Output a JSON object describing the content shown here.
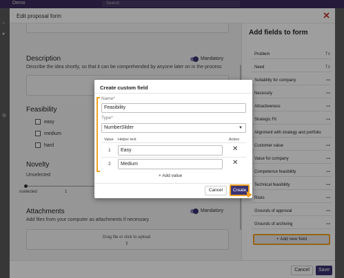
{
  "app": {
    "title": "Demo",
    "search_placeholder": "Search"
  },
  "dialog": {
    "title": "Edit proposal form",
    "close_icon": "close-icon"
  },
  "form": {
    "description": {
      "title": "Description",
      "mandatory_label": "Mandatory",
      "hint": "Describe the idea shortly, so that it can be comprehended by anyone later on in the process"
    },
    "feasibility": {
      "title": "Feasibility",
      "options": [
        "easy",
        "medium",
        "hard"
      ]
    },
    "novelty": {
      "title": "Novelty",
      "status": "Unselected",
      "slider_labels": [
        "nselected",
        "1"
      ]
    },
    "attachments": {
      "title": "Attachments",
      "mandatory_label": "Mandatory",
      "hint": "Add files from your computer as attachments if necessary",
      "dropzone": "Drag file or click to upload"
    }
  },
  "sidebar": {
    "title": "Add fields to form",
    "items": [
      {
        "label": "Problem",
        "icon": "text-icon"
      },
      {
        "label": "Need",
        "icon": "text-icon"
      },
      {
        "label": "Suitability for company",
        "icon": "slider-icon"
      },
      {
        "label": "Necessity",
        "icon": "slider-icon"
      },
      {
        "label": "Attractiveness",
        "icon": "slider-icon"
      },
      {
        "label": "Strategic Fit",
        "icon": "slider-icon"
      },
      {
        "label": "Alignment with strategy and portfolio",
        "icon": "slider-icon"
      },
      {
        "label": "Customer value",
        "icon": "slider-icon"
      },
      {
        "label": "Value for company",
        "icon": "slider-icon"
      },
      {
        "label": "Competence feasibility",
        "icon": "slider-icon"
      },
      {
        "label": "Technical feasibility",
        "icon": "slider-icon"
      },
      {
        "label": "Risks",
        "icon": "slider-icon"
      },
      {
        "label": "Grounds of approval",
        "icon": "slider-icon"
      },
      {
        "label": "Grounds of archiving",
        "icon": "slider-icon"
      }
    ],
    "add_new_field": "Add new field"
  },
  "footer": {
    "cancel": "Cancel",
    "save": "Save"
  },
  "modal": {
    "title": "Create custom field",
    "name_label": "Name*",
    "name_value": "Feasibility",
    "type_label": "Type*",
    "type_value": "NumberSlider",
    "col_value": "Value",
    "col_helper": "Helper text",
    "col_action": "Action",
    "rows": [
      {
        "value": "1",
        "helper": "Easy"
      },
      {
        "value": "2",
        "helper": "Medium"
      }
    ],
    "add_value": "Add value",
    "cancel": "Cancel",
    "create": "Create"
  },
  "colors": {
    "accent": "#3b3372",
    "highlight": "#f0a021",
    "close": "#c0392b"
  }
}
